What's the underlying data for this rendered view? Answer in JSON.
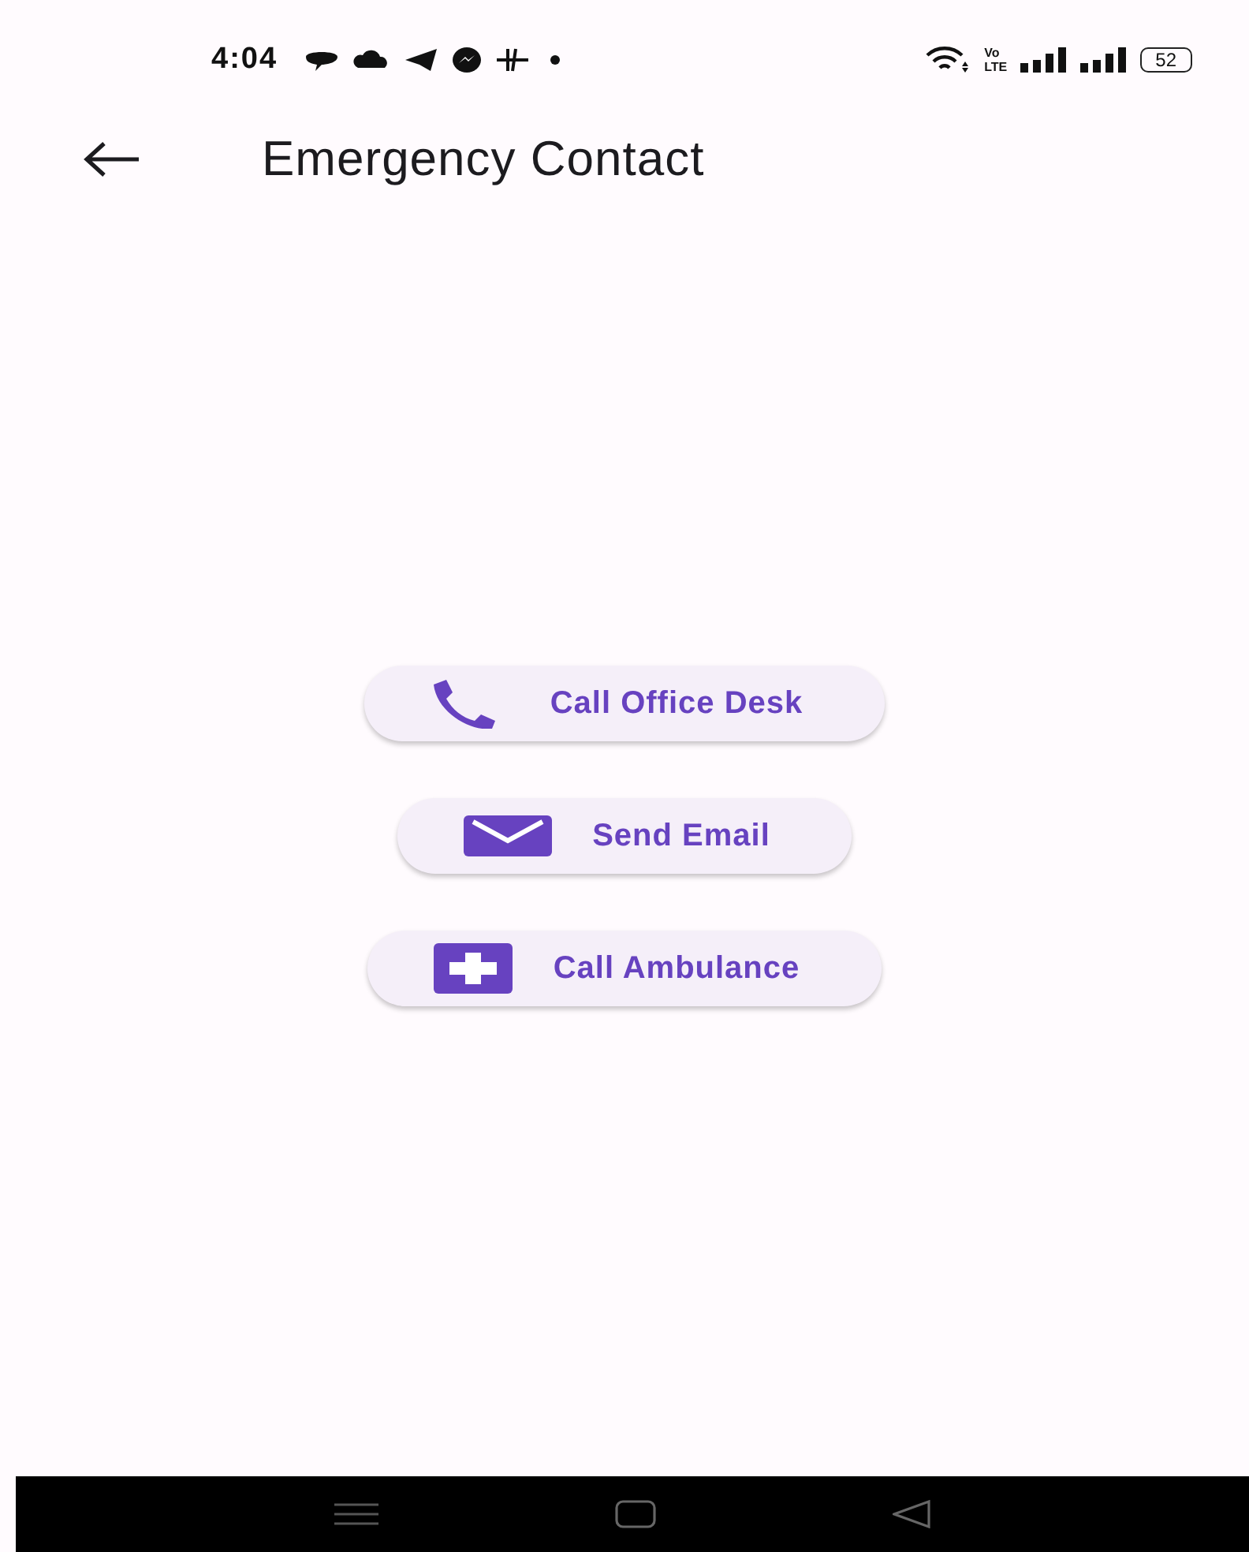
{
  "status_bar": {
    "time": "4:04",
    "network_label": [
      "Vo",
      "LTE"
    ],
    "battery": "52"
  },
  "app_bar": {
    "title": "Emergency Contact"
  },
  "actions": [
    {
      "kind": "phone",
      "label": "Call Office Desk"
    },
    {
      "kind": "email",
      "label": "Send Email"
    },
    {
      "kind": "medical",
      "label": "Call Ambulance"
    }
  ]
}
